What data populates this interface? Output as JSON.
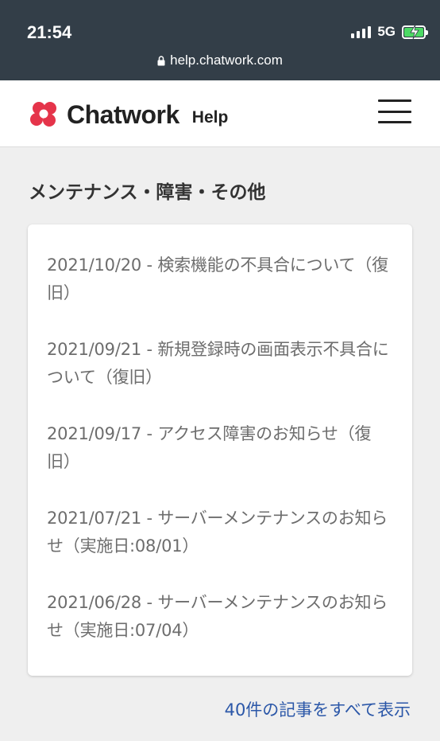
{
  "status": {
    "time": "21:54",
    "network": "5G",
    "url": "help.chatwork.com"
  },
  "header": {
    "logo_text": "Chatwork",
    "help_label": "Help"
  },
  "section": {
    "title": "メンテナンス・障害・その他"
  },
  "articles": [
    {
      "title": "2021/10/20 - 検索機能の不具合について（復旧）"
    },
    {
      "title": "2021/09/21 - 新規登録時の画面表示不具合について（復旧）"
    },
    {
      "title": "2021/09/17 - アクセス障害のお知らせ（復旧）"
    },
    {
      "title": "2021/07/21 - サーバーメンテナンスのお知らせ（実施日:08/01）"
    },
    {
      "title": "2021/06/28 - サーバーメンテナンスのお知らせ（実施日:07/04）"
    }
  ],
  "view_all_label": "40件の記事をすべて表示",
  "colors": {
    "status_bar": "#333e48",
    "link": "#2b57a8",
    "logo_red": "#e5344a",
    "battery_green": "#4cd964"
  }
}
